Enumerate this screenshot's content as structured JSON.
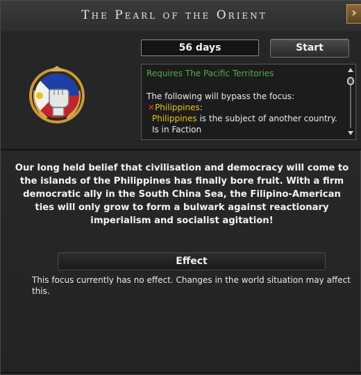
{
  "window": {
    "title": "The Pearl of the Orient",
    "close_icon": "chevron-right-icon"
  },
  "focus": {
    "duration": "56 days",
    "start_label": "Start",
    "emblem_icon": "philippines-fist-emblem-icon"
  },
  "requirements": {
    "title": "Requires The Pacific Territories",
    "bypass_intro": "The following will bypass the focus:",
    "country": "Philippines",
    "country_colon": ":",
    "cond1_country": "Philippines",
    "cond1_text": " is the subject of another country.",
    "cond2_text": "Is in Faction"
  },
  "description": "Our long held belief that civilisation and democracy will come to the islands of the Philippines has finally bore fruit. With a firm democratic ally in the South China Sea, the Filipino-American ties will only grow to form a bulwark against reactionary imperialism and socialist agitation!",
  "effect": {
    "header": "Effect",
    "text": "This focus currently has no effect. Changes in the world situation may affect this."
  },
  "colors": {
    "requirement_green": "#4fae4a",
    "country_yellow": "#e7c31c",
    "fail_red": "#d8402a"
  }
}
